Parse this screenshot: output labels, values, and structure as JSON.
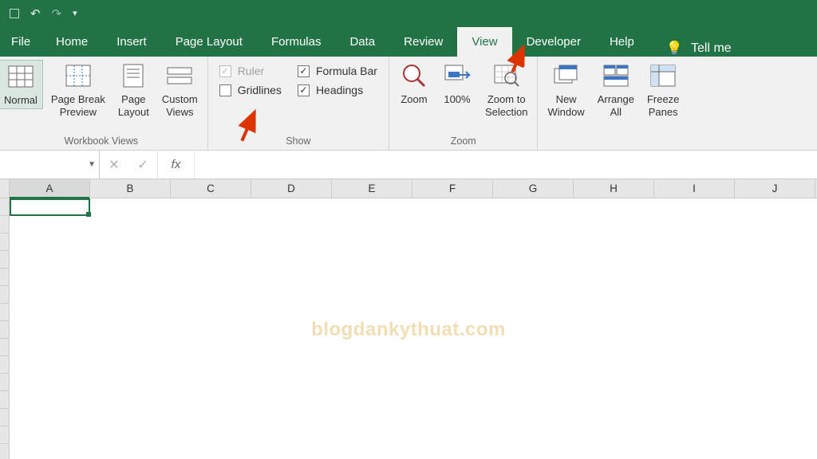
{
  "qat": {
    "undo": "↶",
    "redo": "↷"
  },
  "tabs": [
    "File",
    "Home",
    "Insert",
    "Page Layout",
    "Formulas",
    "Data",
    "Review",
    "View",
    "Developer",
    "Help"
  ],
  "active_tab": "View",
  "tellme": {
    "label": "Tell me"
  },
  "ribbon": {
    "workbook_views": {
      "label": "Workbook Views",
      "normal": "Normal",
      "page_break": "Page Break\nPreview",
      "page_layout": "Page\nLayout",
      "custom_views": "Custom\nViews"
    },
    "show": {
      "label": "Show",
      "ruler": {
        "label": "Ruler",
        "checked": true,
        "disabled": true
      },
      "gridlines": {
        "label": "Gridlines",
        "checked": false
      },
      "formula_bar": {
        "label": "Formula Bar",
        "checked": true
      },
      "headings": {
        "label": "Headings",
        "checked": true
      }
    },
    "zoom": {
      "label": "Zoom",
      "zoom": "Zoom",
      "hundred": "100%",
      "to_selection": "Zoom to\nSelection"
    },
    "window": {
      "new_window": "New\nWindow",
      "arrange_all": "Arrange\nAll",
      "freeze_panes": "Freeze\nPanes"
    }
  },
  "formula_bar": {
    "name_box": "",
    "fx": "fx",
    "value": ""
  },
  "columns": [
    "A",
    "B",
    "C",
    "D",
    "E",
    "F",
    "G",
    "H",
    "I",
    "J"
  ],
  "selected_column": "A",
  "watermark": "blogdankythuat.com"
}
